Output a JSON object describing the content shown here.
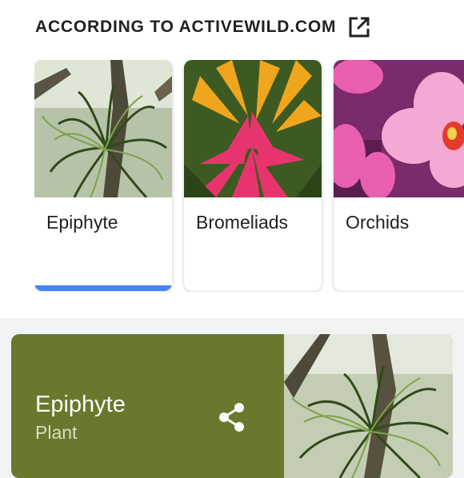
{
  "source": {
    "label": "ACCORDING TO ACTIVEWILD.COM",
    "icon": "external-link-icon"
  },
  "carousel": {
    "items": [
      {
        "label": "Epiphyte",
        "selected": true,
        "image": "epiphyte-photo"
      },
      {
        "label": "Bromeliads",
        "selected": false,
        "image": "bromeliad-photo"
      },
      {
        "label": "Orchids",
        "selected": false,
        "image": "orchid-photo"
      }
    ]
  },
  "panel": {
    "title": "Epiphyte",
    "subtitle": "Plant",
    "share_icon": "share-icon",
    "image": "epiphyte-photo",
    "background": "#67792d"
  },
  "colors": {
    "accent": "#4285f4",
    "panel": "#67792d"
  }
}
